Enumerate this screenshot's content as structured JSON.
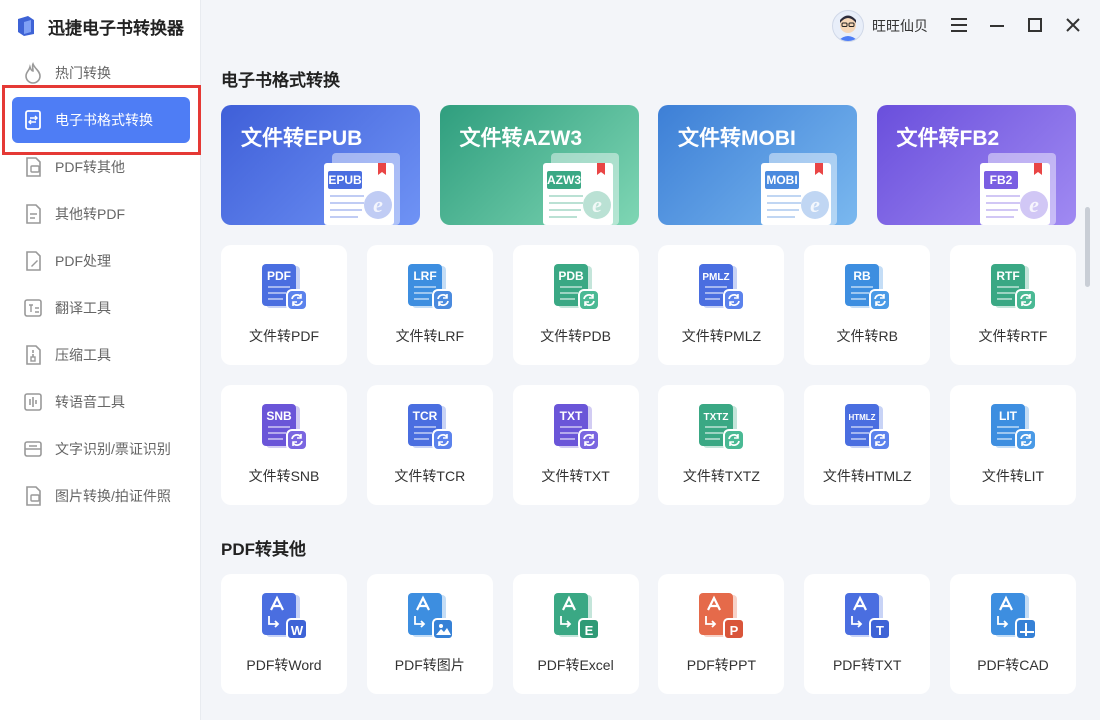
{
  "app": {
    "title": "迅捷电子书转换器"
  },
  "user": {
    "name": "旺旺仙贝"
  },
  "sidebar": {
    "items": [
      {
        "label": "热门转换",
        "icon": "flame-icon"
      },
      {
        "label": "电子书格式转换",
        "icon": "ebook-convert-icon",
        "active": true
      },
      {
        "label": "PDF转其他",
        "icon": "pdf-convert-icon"
      },
      {
        "label": "其他转PDF",
        "icon": "to-pdf-icon"
      },
      {
        "label": "PDF处理",
        "icon": "pdf-edit-icon"
      },
      {
        "label": "翻译工具",
        "icon": "translate-icon"
      },
      {
        "label": "压缩工具",
        "icon": "compress-icon"
      },
      {
        "label": "转语音工具",
        "icon": "voice-icon"
      },
      {
        "label": "文字识别/票证识别",
        "icon": "ocr-icon"
      },
      {
        "label": "图片转换/拍证件照",
        "icon": "image-icon"
      }
    ]
  },
  "sections": {
    "ebook": {
      "title": "电子书格式转换"
    },
    "pdf": {
      "title": "PDF转其他"
    }
  },
  "banners": [
    {
      "title": "文件转EPUB",
      "tag": "EPUB",
      "colors": [
        "#3f5fd8",
        "#6f93f5"
      ],
      "accent": "#4a6ee0"
    },
    {
      "title": "文件转AZW3",
      "tag": "AZW3",
      "colors": [
        "#2f9e7e",
        "#7fd6b4"
      ],
      "accent": "#3aa884"
    },
    {
      "title": "文件转MOBI",
      "tag": "MOBI",
      "colors": [
        "#3d7fd6",
        "#7ab8ef"
      ],
      "accent": "#4a8ade"
    },
    {
      "title": "文件转FB2",
      "tag": "FB2",
      "colors": [
        "#6a4fdc",
        "#a08af2"
      ],
      "accent": "#7a5ee2"
    }
  ],
  "ebook_cards": [
    {
      "label": "文件转PDF",
      "tag": "PDF",
      "color": "#4a6ee0",
      "badge": "#5b82ec"
    },
    {
      "label": "文件转LRF",
      "tag": "LRF",
      "color": "#3d8ee0",
      "badge": "#4a8ade"
    },
    {
      "label": "文件转PDB",
      "tag": "PDB",
      "color": "#3aa884",
      "badge": "#4ab994"
    },
    {
      "label": "文件转PMLZ",
      "tag": "PMLZ",
      "color": "#4a6ee0",
      "badge": "#5b82ec"
    },
    {
      "label": "文件转RB",
      "tag": "RB",
      "color": "#3d8ee0",
      "badge": "#4a9ae6"
    },
    {
      "label": "文件转RTF",
      "tag": "RTF",
      "color": "#3aa884",
      "badge": "#4ab994"
    },
    {
      "label": "文件转SNB",
      "tag": "SNB",
      "color": "#6a55d8",
      "badge": "#7a66e0"
    },
    {
      "label": "文件转TCR",
      "tag": "TCR",
      "color": "#4a6ee0",
      "badge": "#5b82ec"
    },
    {
      "label": "文件转TXT",
      "tag": "TXT",
      "color": "#6a55d8",
      "badge": "#7a66e0"
    },
    {
      "label": "文件转TXTZ",
      "tag": "TXTZ",
      "color": "#3aa884",
      "badge": "#4ab994"
    },
    {
      "label": "文件转HTMLZ",
      "tag": "HTMLZ",
      "color": "#4a6ee0",
      "badge": "#5b82ec"
    },
    {
      "label": "文件转LIT",
      "tag": "LIT",
      "color": "#3d8ee0",
      "badge": "#4a9ae6"
    }
  ],
  "pdf_cards": [
    {
      "label": "PDF转Word",
      "sub": "W",
      "color": "#4a6ee0",
      "badge": "#3e63d6"
    },
    {
      "label": "PDF转图片",
      "sub": "image",
      "color": "#3d8ee0",
      "badge": "#3681d6"
    },
    {
      "label": "PDF转Excel",
      "sub": "E",
      "color": "#3aa884",
      "badge": "#2f9a76"
    },
    {
      "label": "PDF转PPT",
      "sub": "P",
      "color": "#e56a4a",
      "badge": "#d9553a"
    },
    {
      "label": "PDF转TXT",
      "sub": "T",
      "color": "#4a6ee0",
      "badge": "#3e63d6"
    },
    {
      "label": "PDF转CAD",
      "sub": "cad",
      "color": "#3d8ee0",
      "badge": "#3681d6"
    }
  ]
}
